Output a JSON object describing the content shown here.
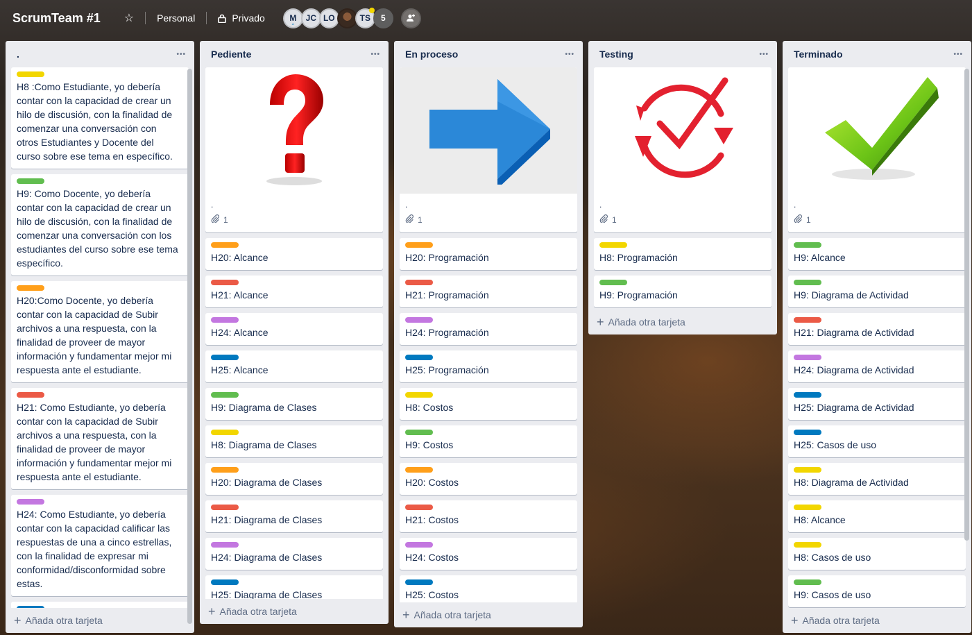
{
  "header": {
    "board_title": "ScrumTeam #1",
    "workspace": "Personal",
    "visibility": "Privado",
    "members": [
      {
        "initials": "M",
        "type": "initials"
      },
      {
        "initials": "JC",
        "type": "initials"
      },
      {
        "initials": "LO",
        "type": "initials"
      },
      {
        "initials": "",
        "type": "photo"
      },
      {
        "initials": "TS",
        "type": "initials"
      }
    ],
    "member_count": "5"
  },
  "colors": {
    "yellow": "#f2d600",
    "green": "#61bd4f",
    "orange": "#ff9f1a",
    "red": "#eb5a46",
    "purple": "#c377e0",
    "blue": "#0079bf"
  },
  "lists": [
    {
      "title": ".",
      "add_label": "Añada otra tarjeta",
      "cards": [
        {
          "label": "yellow",
          "text": "H8 :Como Estudiante, yo debería contar con la capacidad de crear un hilo de discusión, con la finalidad de comenzar una conversación con otros Estudiantes y Docente del curso sobre ese tema en específico."
        },
        {
          "label": "green",
          "text": "H9: Como Docente, yo debería contar con la capacidad de crear un hilo de discusión, con la finalidad de comenzar una conversación con los estudiantes del curso sobre ese tema específico."
        },
        {
          "label": "orange",
          "text": "H20:Como Docente, yo debería contar con la capacidad de Subir archivos a una respuesta, con la finalidad de proveer de mayor información y fundamentar mejor mi respuesta ante el estudiante."
        },
        {
          "label": "red",
          "text": "H21: Como Estudiante, yo debería contar con la capacidad de Subir archivos a una respuesta, con la finalidad de proveer de mayor información y fundamentar mejor mi respuesta ante el estudiante."
        },
        {
          "label": "purple",
          "text": "H24: Como Estudiante, yo debería contar con la capacidad calificar las respuestas de una a cinco estrellas, con la finalidad de expresar mi conformidad/disconformidad sobre estas."
        },
        {
          "label": "blue",
          "text": ""
        }
      ]
    },
    {
      "title": "Pediente",
      "add_label": "Añada otra tarjeta",
      "cover": {
        "icon": "question-mark-icon",
        "text": ".",
        "attachments": "1"
      },
      "cards": [
        {
          "label": "orange",
          "text": "H20: Alcance"
        },
        {
          "label": "red",
          "text": "H21: Alcance"
        },
        {
          "label": "purple",
          "text": "H24: Alcance"
        },
        {
          "label": "blue",
          "text": "H25: Alcance"
        },
        {
          "label": "green",
          "text": "H9: Diagrama de Clases"
        },
        {
          "label": "yellow",
          "text": "H8: Diagrama de Clases"
        },
        {
          "label": "orange",
          "text": "H20: Diagrama de Clases"
        },
        {
          "label": "red",
          "text": "H21: Diagrama de Clases"
        },
        {
          "label": "purple",
          "text": "H24: Diagrama de Clases"
        },
        {
          "label": "blue",
          "text": "H25: Diagrama de Clases"
        }
      ]
    },
    {
      "title": "En proceso",
      "add_label": "Añada otra tarjeta",
      "cover": {
        "icon": "arrow-right-icon",
        "text": ".",
        "attachments": "1"
      },
      "cards": [
        {
          "label": "orange",
          "text": "H20: Programación"
        },
        {
          "label": "red",
          "text": "H21: Programación"
        },
        {
          "label": "purple",
          "text": "H24: Programación"
        },
        {
          "label": "blue",
          "text": "H25: Programación"
        },
        {
          "label": "yellow",
          "text": "H8: Costos"
        },
        {
          "label": "green",
          "text": "H9: Costos"
        },
        {
          "label": "orange",
          "text": "H20: Costos"
        },
        {
          "label": "red",
          "text": "H21: Costos"
        },
        {
          "label": "purple",
          "text": "H24: Costos"
        },
        {
          "label": "blue",
          "text": "H25: Costos"
        }
      ]
    },
    {
      "title": "Testing",
      "add_label": "Añada otra tarjeta",
      "cover": {
        "icon": "cycle-check-icon",
        "text": ".",
        "attachments": "1"
      },
      "cards": [
        {
          "label": "yellow",
          "text": "H8: Programación"
        },
        {
          "label": "green",
          "text": "H9: Programación"
        }
      ]
    },
    {
      "title": "Terminado",
      "add_label": "Añada otra tarjeta",
      "cover": {
        "icon": "checkmark-icon",
        "text": ".",
        "attachments": "1"
      },
      "cards": [
        {
          "label": "green",
          "text": "H9: Alcance"
        },
        {
          "label": "green",
          "text": "H9: Diagrama de Actividad"
        },
        {
          "label": "red",
          "text": "H21: Diagrama de Actividad"
        },
        {
          "label": "purple",
          "text": "H24: Diagrama de Actividad"
        },
        {
          "label": "blue",
          "text": "H25: Diagrama de Actividad"
        },
        {
          "label": "blue",
          "text": "H25: Casos de uso"
        },
        {
          "label": "yellow",
          "text": "H8: Diagrama de Actividad"
        },
        {
          "label": "yellow",
          "text": "H8: Alcance"
        },
        {
          "label": "yellow",
          "text": "H8: Casos de uso"
        },
        {
          "label": "green",
          "text": "H9: Casos de uso"
        },
        {
          "label": "orange",
          "text": ""
        }
      ]
    }
  ]
}
